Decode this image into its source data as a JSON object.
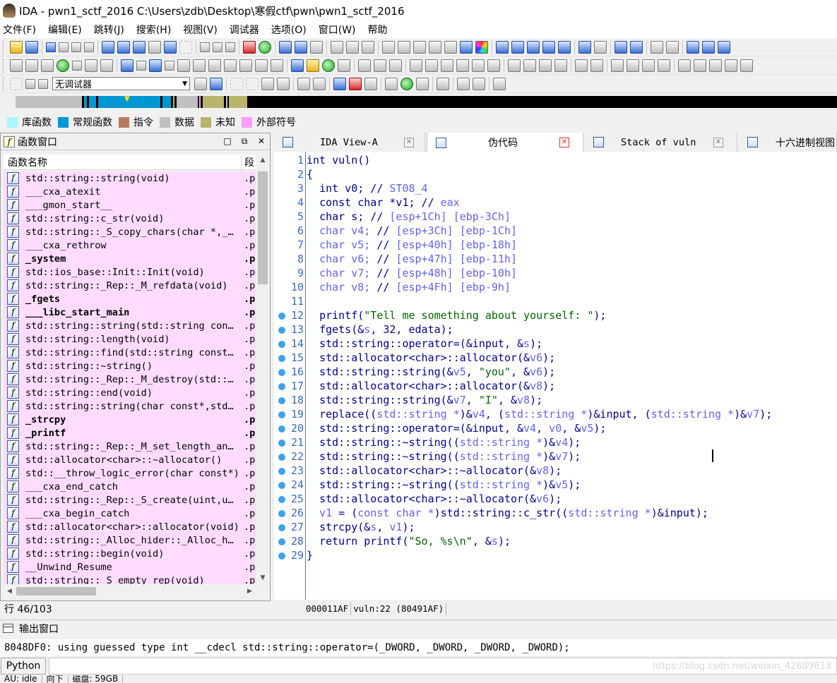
{
  "window": {
    "title": "IDA - pwn1_sctf_2016 C:\\Users\\zdb\\Desktop\\寒假ctf\\pwn\\pwn1_sctf_2016"
  },
  "menu": [
    "文件(F)",
    "编辑(E)",
    "跳转(J)",
    "搜索(H)",
    "视图(V)",
    "调试器",
    "选项(O)",
    "窗口(W)",
    "帮助"
  ],
  "debugger": {
    "selected": "无调试器"
  },
  "legend": [
    {
      "label": "库函数",
      "color": "#aaf5ff"
    },
    {
      "label": "常规函数",
      "color": "#0096d2"
    },
    {
      "label": "指令",
      "color": "#b47c5c"
    },
    {
      "label": "数据",
      "color": "#c0c0c0"
    },
    {
      "label": "未知",
      "color": "#b8b46c"
    },
    {
      "label": "外部符号",
      "color": "#ff9cff"
    }
  ],
  "functions_panel": {
    "title": "函数窗口",
    "col_name": "函数名称",
    "col_segment": "段",
    "rows": [
      {
        "name": "std::string::string(void)",
        "seg": ".p",
        "bold": false
      },
      {
        "name": "___cxa_atexit",
        "seg": ".p",
        "bold": false
      },
      {
        "name": "___gmon_start__",
        "seg": ".p",
        "bold": false
      },
      {
        "name": "std::string::c_str(void)",
        "seg": ".p",
        "bold": false
      },
      {
        "name": "std::string::_S_copy_chars(char *,_…",
        "seg": ".p",
        "bold": false
      },
      {
        "name": "___cxa_rethrow",
        "seg": ".p",
        "bold": false
      },
      {
        "name": "_system",
        "seg": ".p",
        "bold": true
      },
      {
        "name": "std::ios_base::Init::Init(void)",
        "seg": ".p",
        "bold": false
      },
      {
        "name": "std::string::_Rep::_M_refdata(void)",
        "seg": ".p",
        "bold": false
      },
      {
        "name": "_fgets",
        "seg": ".p",
        "bold": true
      },
      {
        "name": "___libc_start_main",
        "seg": ".p",
        "bold": true
      },
      {
        "name": "std::string::string(std::string con…",
        "seg": ".p",
        "bold": false
      },
      {
        "name": "std::string::length(void)",
        "seg": ".p",
        "bold": false
      },
      {
        "name": "std::string::find(std::string const…",
        "seg": ".p",
        "bold": false
      },
      {
        "name": "std::string::~string()",
        "seg": ".p",
        "bold": false
      },
      {
        "name": "std::string::_Rep::_M_destroy(std::…",
        "seg": ".p",
        "bold": false
      },
      {
        "name": "std::string::end(void)",
        "seg": ".p",
        "bold": false
      },
      {
        "name": "std::string::string(char const*,std…",
        "seg": ".p",
        "bold": false
      },
      {
        "name": "_strcpy",
        "seg": ".p",
        "bold": true
      },
      {
        "name": "_printf",
        "seg": ".p",
        "bold": true
      },
      {
        "name": "std::string::_Rep::_M_set_length_an…",
        "seg": ".p",
        "bold": false
      },
      {
        "name": "std::allocator<char>::~allocator()",
        "seg": ".p",
        "bold": false
      },
      {
        "name": "std::__throw_logic_error(char const*)",
        "seg": ".p",
        "bold": false
      },
      {
        "name": "___cxa_end_catch",
        "seg": ".p",
        "bold": false
      },
      {
        "name": "std::string::_Rep::_S_create(uint,u…",
        "seg": ".p",
        "bold": false
      },
      {
        "name": "___cxa_begin_catch",
        "seg": ".p",
        "bold": false
      },
      {
        "name": "std::allocator<char>::allocator(void)",
        "seg": ".p",
        "bold": false
      },
      {
        "name": "std::string::_Alloc_hider::_Alloc_h…",
        "seg": ".p",
        "bold": false
      },
      {
        "name": "std::string::begin(void)",
        "seg": ".p",
        "bold": false
      },
      {
        "name": "__Unwind_Resume",
        "seg": ".p",
        "bold": false
      },
      {
        "name": "std::string::_S_empty_rep(void)",
        "seg": ".p",
        "bold": false
      }
    ]
  },
  "line_status": "行 46/103",
  "tabs": [
    {
      "label": "IDA View-A",
      "active": false,
      "cn": false
    },
    {
      "label": "伪代码",
      "active": true,
      "cn": true
    },
    {
      "label": "Stack of vuln",
      "active": false,
      "cn": false
    },
    {
      "label": "十六进制视图",
      "active": false,
      "cn": true
    }
  ],
  "code": [
    {
      "n": "1",
      "bp": false,
      "html": "int vuln()"
    },
    {
      "n": "2",
      "bp": false,
      "html": "{"
    },
    {
      "n": "3",
      "bp": false,
      "html": "  <span class='k'>int v0; // </span><span class='g'>ST08_4</span>"
    },
    {
      "n": "4",
      "bp": false,
      "html": "  <span class='k'>const char *v1; // </span><span class='g'>eax</span>"
    },
    {
      "n": "5",
      "bp": false,
      "html": "  <span class='k'>char s; // </span><span class='g'>[esp+1Ch] [ebp-3Ch]</span>"
    },
    {
      "n": "6",
      "bp": false,
      "html": "  <span class='g'>char v4; </span><span class='k'>// </span><span class='g'>[esp+3Ch] [ebp-1Ch]</span>"
    },
    {
      "n": "7",
      "bp": false,
      "html": "  <span class='g'>char v5; </span><span class='k'>// </span><span class='g'>[esp+40h] [ebp-18h]</span>"
    },
    {
      "n": "8",
      "bp": false,
      "html": "  <span class='g'>char v6; </span><span class='k'>// </span><span class='g'>[esp+47h] [ebp-11h]</span>"
    },
    {
      "n": "9",
      "bp": false,
      "html": "  <span class='g'>char v7; </span><span class='k'>// </span><span class='g'>[esp+48h] [ebp-10h]</span>"
    },
    {
      "n": "10",
      "bp": false,
      "html": "  <span class='g'>char v8; </span><span class='k'>// </span><span class='g'>[esp+4Fh] [ebp-9h]</span>"
    },
    {
      "n": "11",
      "bp": false,
      "html": ""
    },
    {
      "n": "12",
      "bp": true,
      "html": "  <span class='k'>printf(</span><span class='s'>\"Tell me something about yourself: \"</span><span class='k'>);</span>"
    },
    {
      "n": "13",
      "bp": true,
      "html": "  <span class='k'>fgets(&amp;</span><span class='g'>s</span><span class='k'>, 32, edata);</span>"
    },
    {
      "n": "14",
      "bp": true,
      "html": "  <span class='k'>std::string::operator=(&amp;input, &amp;</span><span class='g'>s</span><span class='k'>);</span>"
    },
    {
      "n": "15",
      "bp": true,
      "html": "  <span class='k'>std::allocator&lt;char&gt;::allocator(&amp;</span><span class='g'>v6</span><span class='k'>);</span>"
    },
    {
      "n": "16",
      "bp": true,
      "html": "  <span class='k'>std::string::string(&amp;</span><span class='g'>v5</span><span class='k'>, </span><span class='s'>\"you\"</span><span class='k'>, &amp;</span><span class='g'>v6</span><span class='k'>);</span>"
    },
    {
      "n": "17",
      "bp": true,
      "html": "  <span class='k'>std::allocator&lt;char&gt;::allocator(&amp;</span><span class='g'>v8</span><span class='k'>);</span>"
    },
    {
      "n": "18",
      "bp": true,
      "html": "  <span class='k'>std::string::string(&amp;</span><span class='g'>v7</span><span class='k'>, </span><span class='s'>\"I\"</span><span class='k'>, &amp;</span><span class='g'>v8</span><span class='k'>);</span>"
    },
    {
      "n": "19",
      "bp": true,
      "html": "  <span class='k'>replace((</span><span class='g'>std::string *</span><span class='k'>)&amp;</span><span class='g'>v4</span><span class='k'>, (</span><span class='g'>std::string *</span><span class='k'>)&amp;input, (</span><span class='g'>std::string *</span><span class='k'>)&amp;</span><span class='g'>v7</span><span class='k'>);</span>"
    },
    {
      "n": "20",
      "bp": true,
      "html": "  <span class='k'>std::string::operator=(&amp;input, &amp;</span><span class='g'>v4</span><span class='k'>, </span><span class='g'>v0</span><span class='k'>, &amp;</span><span class='g'>v5</span><span class='k'>);</span>"
    },
    {
      "n": "21",
      "bp": true,
      "html": "  <span class='k'>std::string::~string((</span><span class='g'>std::string *</span><span class='k'>)&amp;</span><span class='g'>v4</span><span class='k'>);</span>"
    },
    {
      "n": "22",
      "bp": true,
      "html": "  <span class='k'>std::string::~string((</span><span class='g'>std::string *</span><span class='k'>)&amp;</span><span class='g'>v7</span><span class='k'>);</span>"
    },
    {
      "n": "23",
      "bp": true,
      "html": "  <span class='k'>std::allocator&lt;char&gt;::~allocator(&amp;</span><span class='g'>v8</span><span class='k'>);</span>"
    },
    {
      "n": "24",
      "bp": true,
      "html": "  <span class='k'>std::string::~string((</span><span class='g'>std::string *</span><span class='k'>)&amp;</span><span class='g'>v5</span><span class='k'>);</span>"
    },
    {
      "n": "25",
      "bp": true,
      "html": "  <span class='k'>std::allocator&lt;char&gt;::~allocator(&amp;</span><span class='g'>v6</span><span class='k'>);</span>"
    },
    {
      "n": "26",
      "bp": true,
      "html": "  <span class='g'>v1</span><span class='k'> = (</span><span class='g'>const char *</span><span class='k'>)std::string::c_str((</span><span class='g'>std::string *</span><span class='k'>)&amp;input);</span>"
    },
    {
      "n": "27",
      "bp": true,
      "html": "  <span class='k'>strcpy(&amp;</span><span class='g'>s</span><span class='k'>, </span><span class='g'>v1</span><span class='k'>);</span>"
    },
    {
      "n": "28",
      "bp": true,
      "html": "  <span class='k'>return printf(</span><span class='s'>\"So, %s\\n\"</span><span class='k'>, &amp;</span><span class='g'>s</span><span class='k'>);</span>"
    },
    {
      "n": "29",
      "bp": true,
      "html": "}"
    }
  ],
  "code_status": {
    "address": "000011AF",
    "location": "vuln:22 (80491AF)"
  },
  "output": {
    "title": "输出窗口",
    "line": "8048DF0: using guessed type int __cdecl std::string::operator=(_DWORD, _DWORD, _DWORD, _DWORD);",
    "python_label": "Python",
    "watermark": "https://blog.csdn.net/weixin_42689613"
  },
  "status": {
    "mode": "AU: idle",
    "direction": "向下",
    "disk": "磁盘: 59GB"
  }
}
